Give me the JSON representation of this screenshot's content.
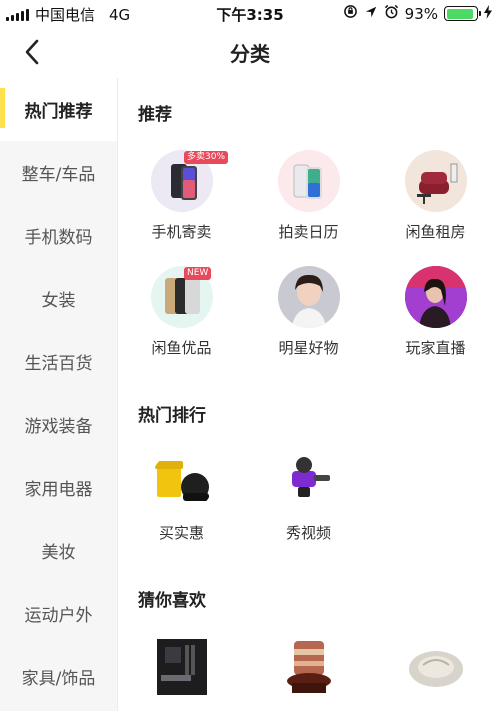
{
  "status_bar": {
    "carrier": "中国电信",
    "network": "4G",
    "time": "下午3:35",
    "battery_percent": "93%",
    "battery_level": 0.93
  },
  "nav": {
    "title": "分类",
    "back_icon": "chevron-left-icon"
  },
  "sidebar": {
    "items": [
      {
        "label": "热门推荐",
        "active": true
      },
      {
        "label": "整车/车品"
      },
      {
        "label": "手机数码"
      },
      {
        "label": "女装"
      },
      {
        "label": "生活百货"
      },
      {
        "label": "游戏装备"
      },
      {
        "label": "家用电器"
      },
      {
        "label": "美妆"
      },
      {
        "label": "运动户外"
      },
      {
        "label": "家具/饰品"
      }
    ]
  },
  "sections": {
    "recommend": {
      "title": "推荐",
      "items": [
        {
          "label": "手机寄卖",
          "badge": "多卖30%"
        },
        {
          "label": "拍卖日历"
        },
        {
          "label": "闲鱼租房"
        },
        {
          "label": "闲鱼优品",
          "badge": "NEW"
        },
        {
          "label": "明星好物"
        },
        {
          "label": "玩家直播"
        }
      ]
    },
    "hot_ranking": {
      "title": "热门排行",
      "items": [
        {
          "label": "买实惠"
        },
        {
          "label": "秀视频"
        }
      ]
    },
    "guess": {
      "title": "猜你喜欢"
    }
  },
  "colors": {
    "accent": "#ffe14d",
    "battery": "#4cd964",
    "badge": "#e74a5b",
    "sidebar_bg": "#f6f6f6"
  }
}
